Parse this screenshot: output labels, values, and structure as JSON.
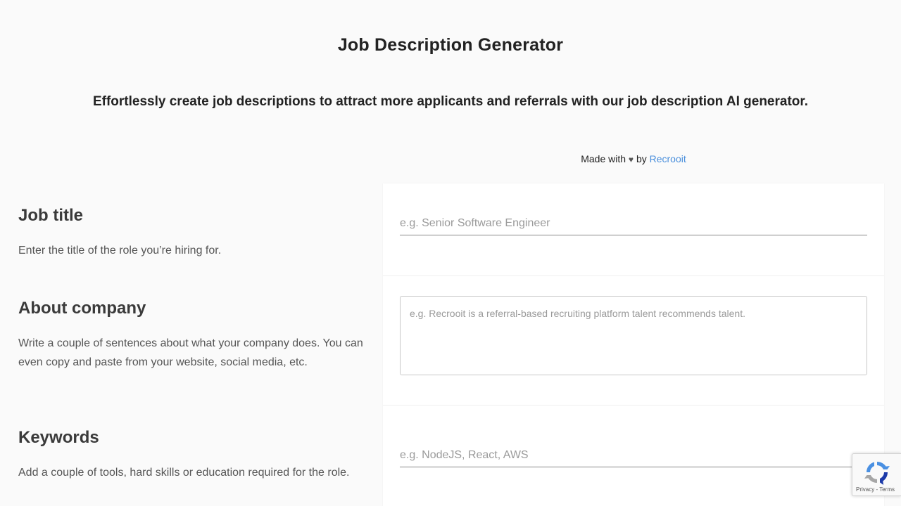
{
  "header": {
    "title": "Job Description Generator",
    "subtitle": "Effortlessly create job descriptions to attract more applicants and referrals with our job description AI generator."
  },
  "credit": {
    "made_with": "Made with",
    "heart_glyph": "♥",
    "by": "by",
    "link_text": "Recrooit"
  },
  "sections": {
    "job_title": {
      "heading": "Job title",
      "description": "Enter the title of the role you’re hiring for.",
      "placeholder": "e.g. Senior Software Engineer",
      "value": ""
    },
    "about_company": {
      "heading": "About company",
      "description": "Write a couple of sentences about what your company does. You can even copy and paste from your website, social media, etc.",
      "placeholder": "e.g. Recrooit is a referral-based recruiting platform talent recommends talent.",
      "value": ""
    },
    "keywords": {
      "heading": "Keywords",
      "description": "Add a couple of tools, hard skills or education required for the role.",
      "placeholder": "e.g. NodeJS, React, AWS",
      "value": ""
    }
  },
  "recaptcha": {
    "privacy": "Privacy",
    "separator": " - ",
    "terms": "Terms",
    "icon": "recaptcha-logo-icon"
  },
  "colors": {
    "background": "#fafafa",
    "card": "#ffffff",
    "link": "#4a8fdc",
    "text": "#222222"
  }
}
